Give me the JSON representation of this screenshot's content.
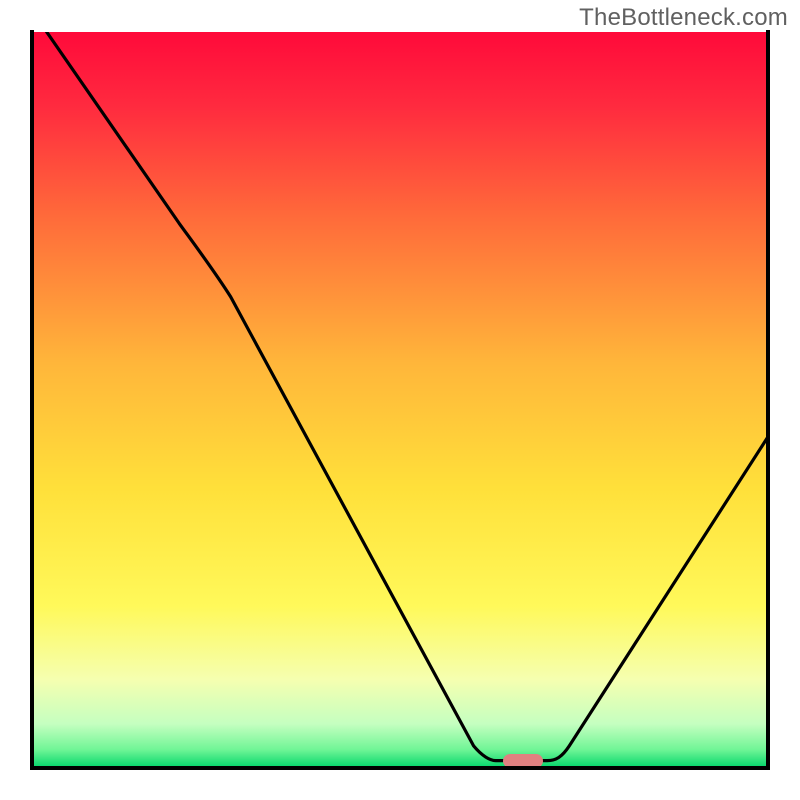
{
  "watermark": "TheBottleneck.com",
  "chart_data": {
    "type": "line",
    "title": "",
    "xlabel": "",
    "ylabel": "",
    "xlim": [
      0,
      100
    ],
    "ylim": [
      0,
      100
    ],
    "grid": false,
    "background": {
      "type": "vertical-gradient",
      "stops": [
        {
          "pos": 0.0,
          "color": "#ff0a3a"
        },
        {
          "pos": 0.1,
          "color": "#ff2a3f"
        },
        {
          "pos": 0.25,
          "color": "#ff6a3a"
        },
        {
          "pos": 0.45,
          "color": "#ffb63a"
        },
        {
          "pos": 0.62,
          "color": "#ffe03a"
        },
        {
          "pos": 0.78,
          "color": "#fff95a"
        },
        {
          "pos": 0.88,
          "color": "#f5ffb0"
        },
        {
          "pos": 0.94,
          "color": "#c5ffc0"
        },
        {
          "pos": 0.975,
          "color": "#70f596"
        },
        {
          "pos": 1.0,
          "color": "#00d56a"
        }
      ]
    },
    "curve": {
      "description": "Bottleneck curve; minimum (~0) around x≈65–70.",
      "points": [
        {
          "x": 2,
          "y": 100
        },
        {
          "x": 20,
          "y": 74
        },
        {
          "x": 27,
          "y": 64
        },
        {
          "x": 60,
          "y": 3
        },
        {
          "x": 63,
          "y": 1
        },
        {
          "x": 70,
          "y": 1
        },
        {
          "x": 73,
          "y": 3
        },
        {
          "x": 100,
          "y": 45
        }
      ]
    },
    "marker": {
      "shape": "rounded-pill",
      "color": "#e08080",
      "x_center": 66.5,
      "y": 1.0,
      "width_pct": 5,
      "height_pct": 1.8
    },
    "frame": {
      "sides": [
        "left",
        "right",
        "bottom"
      ],
      "color": "#000000",
      "width": 4
    }
  }
}
